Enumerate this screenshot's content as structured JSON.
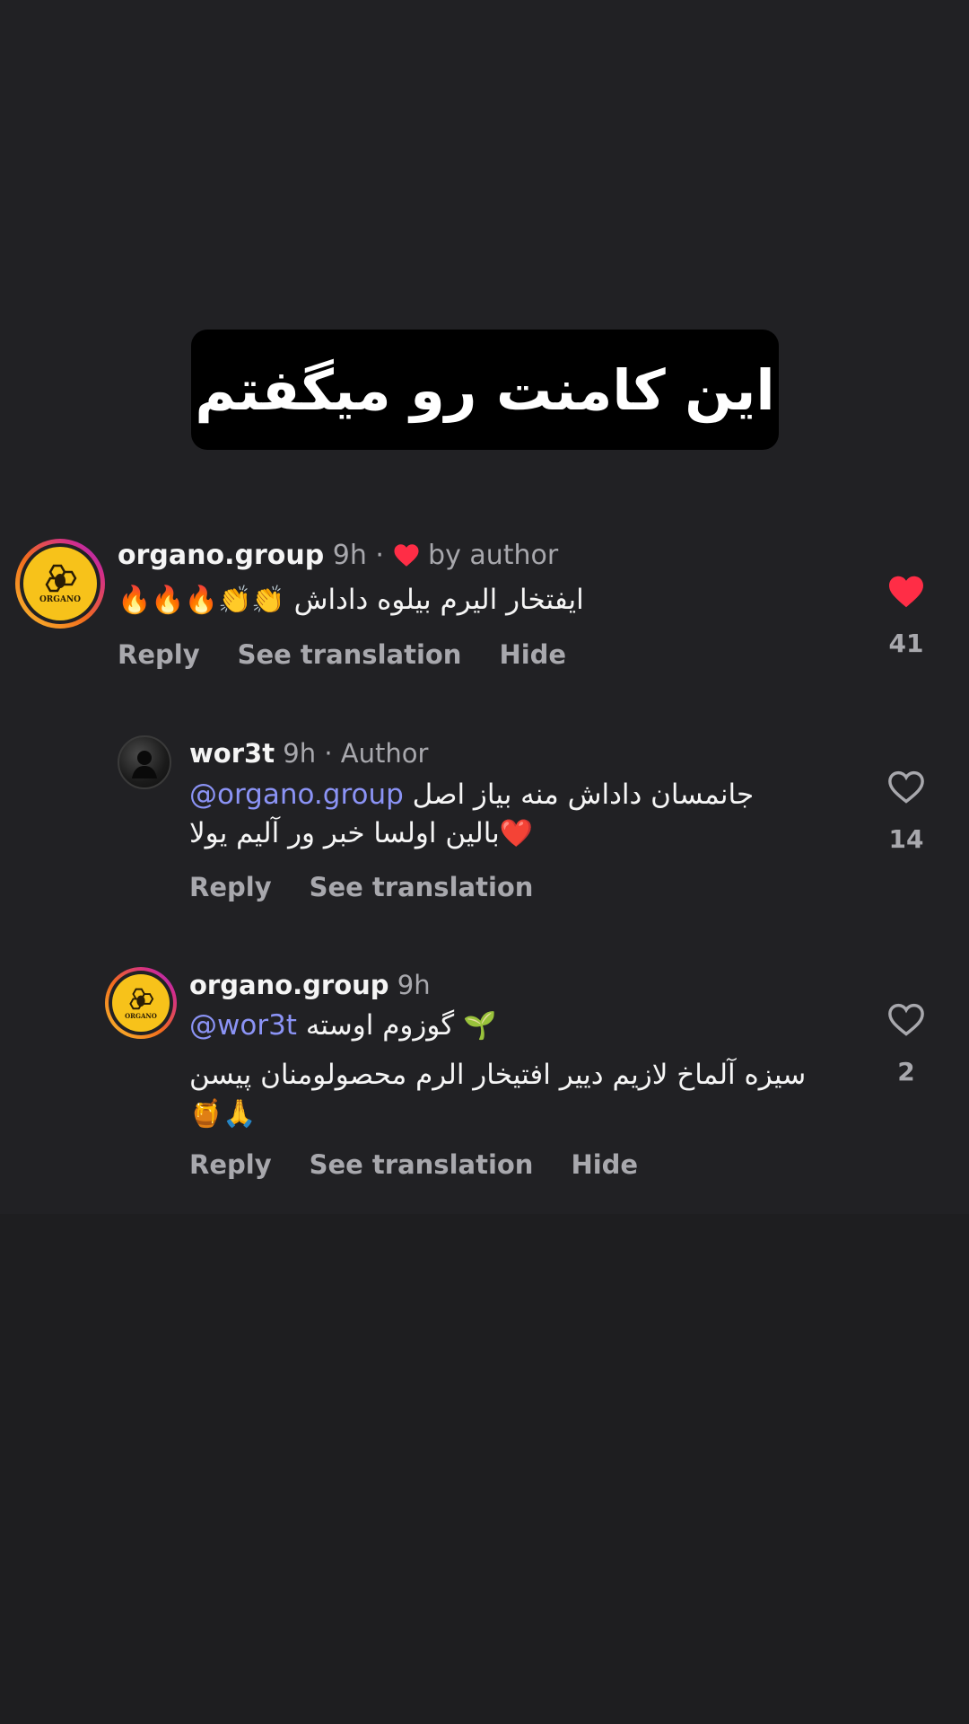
{
  "caption": {
    "text": "این کامنت رو میگفتم"
  },
  "comments": [
    {
      "username": "organo.group",
      "time": "9h",
      "separator": "·",
      "liked_by_author_label": "by author",
      "text_rtl": "ایفتخار الیرم بیلوه داداش",
      "emoji_suffix": "🔥🔥🔥👏👏",
      "actions": [
        "Reply",
        "See translation",
        "Hide"
      ],
      "like_count": "41",
      "liked": true,
      "avatar": {
        "logo_text": "ORGANO",
        "icon": "bee-hive-logo"
      }
    },
    {
      "username": "wor3t",
      "time": "9h",
      "separator": "·",
      "role_label": "Author",
      "mention": "@organo.group",
      "text_line1_rtl": "جانمسان داداش منه بیاز اصل",
      "text_line2_rtl": "بالین اولسا خبر ور آلیم یولا",
      "emoji_line2": "❤️",
      "actions": [
        "Reply",
        "See translation"
      ],
      "like_count": "14",
      "liked": false
    },
    {
      "username": "organo.group",
      "time": "9h",
      "mention": "@wor3t",
      "text_line1_rtl": "گوزوم اوسته",
      "emoji_line1": "🌱",
      "text_line2_rtl": "سیزه آلماخ لازیم دییر افتیخار الرم محصولومنان پیسن",
      "emoji_line3": "🍯🙏",
      "actions": [
        "Reply",
        "See translation",
        "Hide"
      ],
      "like_count": "2",
      "liked": false,
      "avatar": {
        "logo_text": "ORGANO",
        "icon": "bee-hive-logo"
      }
    }
  ],
  "colors": {
    "background": "#1c1c1e",
    "panel": "#212124",
    "meta_text": "#a8a8ad",
    "mention": "#8b93f5",
    "like_red": "#ff2d46"
  }
}
